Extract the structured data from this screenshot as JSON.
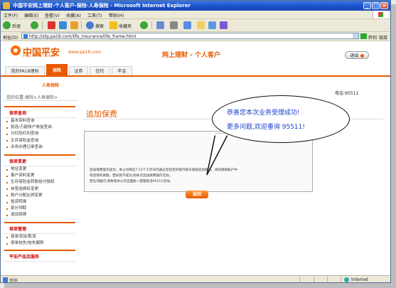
{
  "window": {
    "title": "中国平安网上理财-个人客户-保险-人寿保险 - Microsoft Internet Explorer"
  },
  "menu": [
    "文件(F)",
    "编辑(E)",
    "查看(V)",
    "收藏(A)",
    "工具(T)",
    "帮助(H)"
  ],
  "toolbar": {
    "back_label": "后退",
    "search_label": "搜索",
    "favorites_label": "收藏夹"
  },
  "address": {
    "label": "地址(D)",
    "url": "http://stg.pa18.com/life_insurance/life_frame.html",
    "go_label": "转到",
    "links_label": "链接"
  },
  "header": {
    "logo_cn": "中国平安",
    "logo_en": "PING AN OF CHINA",
    "site": "www.pa18.com",
    "title": "网上理财 - 个人客户",
    "logout_label": "退出"
  },
  "nav": {
    "tabs": [
      "我的PA18理财",
      "保险",
      "证券",
      "信托",
      "年金"
    ],
    "active_index": 1,
    "hotline": "电话:95511",
    "sub_item": "人寿保险"
  },
  "breadcrumb": "您的位置:保险>人寿保险>",
  "sidebar": {
    "sections": [
      {
        "title": "保单查询",
        "items": [
          "基本资料查询",
          "投连/万能账户收益查询",
          "分红险红利查询",
          "生存保险金查询",
          "业务办理记录查询"
        ]
      },
      {
        "title": "保单变更",
        "items": [
          "地址变更",
          "客户资料变更",
          "生存保险金转账给付授权",
          "自垫选择权变更",
          "账户分配比例变更",
          "投资转换",
          "部分领取",
          "追加保费"
        ]
      },
      {
        "title": "保单管理",
        "items": [
          "保单添加/取消",
          "保单挂失/挂失解除"
        ]
      },
      {
        "title": "平安产品及服务",
        "items": []
      }
    ]
  },
  "content": {
    "title": "追加保费",
    "message_lines": [
      "追加保费操作成功。本公司将在7-15个工作日内通过您指定的银行账号收取追加保费。请您确保账户中",
      "有足够的余额。若扣款不成功,则本次追加保费操作无效。",
      "若任何疑问,请致电本公司全国统一客服电话95511咨询。"
    ],
    "back_label": "返回"
  },
  "callout": {
    "line1": "恭喜您本次业务受理成功!",
    "line2": "更多问题,欢迎垂询 95511!"
  },
  "status": {
    "text": "完毕",
    "zone": "Internet"
  },
  "colors": {
    "brand": "#e85a00",
    "callout_text": "#1a3fd0"
  }
}
